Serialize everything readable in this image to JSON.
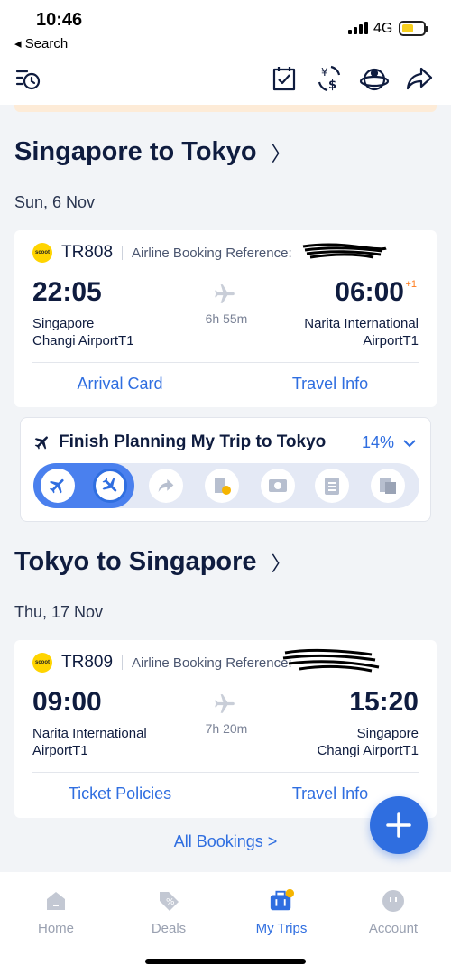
{
  "status": {
    "time": "10:46",
    "back": "◂ Search",
    "network": "4G",
    "battery_level": 0.55
  },
  "toolbar": {
    "icons": [
      "history-icon",
      "calendar-check-icon",
      "currency-exchange-icon",
      "globe-location-icon",
      "share-icon"
    ]
  },
  "outbound": {
    "title": "Singapore to Tokyo",
    "date": "Sun, 6 Nov",
    "flight": "TR808",
    "ref_label": "Airline Booking Reference:",
    "dep_time": "22:05",
    "arr_time": "06:00",
    "day_offset": "+1",
    "duration": "6h 55m",
    "dep_place_1": "Singapore",
    "dep_place_2": "Changi AirportT1",
    "arr_place_1": "Narita International",
    "arr_place_2": "AirportT1",
    "link_left": "Arrival Card",
    "link_right": "Travel Info"
  },
  "planning": {
    "title": "Finish Planning My Trip to Tokyo",
    "percent_label": "14%",
    "progress": 0.14
  },
  "return": {
    "title": "Tokyo to Singapore",
    "date": "Thu, 17 Nov",
    "flight": "TR809",
    "ref_label": "Airline Booking Reference:",
    "dep_time": "09:00",
    "arr_time": "15:20",
    "duration": "7h 20m",
    "dep_place_1": "Narita International",
    "dep_place_2": "AirportT1",
    "arr_place_1": "Singapore",
    "arr_place_2": "Changi AirportT1",
    "link_left": "Ticket Policies",
    "link_right": "Travel Info"
  },
  "all_bookings": "All Bookings  >",
  "airline_logo_text": "scoot",
  "tabs": {
    "home": "Home",
    "deals": "Deals",
    "trips": "My Trips",
    "account": "Account"
  },
  "colors": {
    "accent": "#2f6ee0",
    "text": "#0f1c3f",
    "scoot": "#ffd400"
  }
}
